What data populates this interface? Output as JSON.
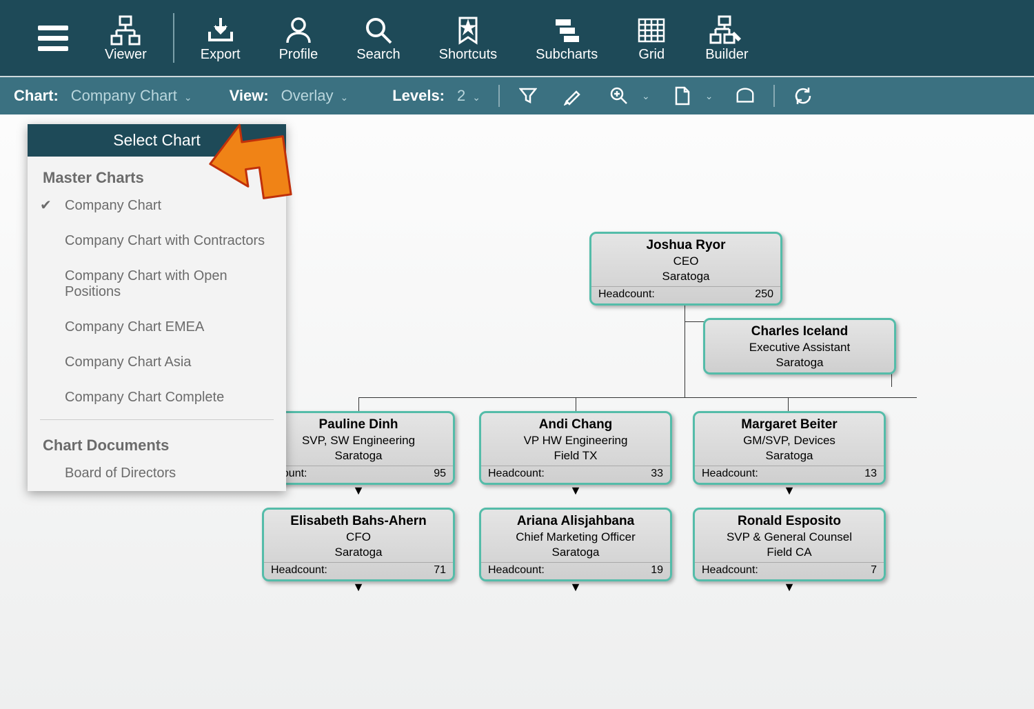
{
  "toolbar": {
    "viewer": "Viewer",
    "export": "Export",
    "profile": "Profile",
    "search": "Search",
    "shortcuts": "Shortcuts",
    "subcharts": "Subcharts",
    "grid": "Grid",
    "builder": "Builder"
  },
  "secondary": {
    "chart_label": "Chart:",
    "chart_value": "Company Chart",
    "view_label": "View:",
    "view_value": "Overlay",
    "levels_label": "Levels:",
    "levels_value": "2"
  },
  "dropdown": {
    "header": "Select Chart",
    "section1": "Master Charts",
    "items1": [
      "Company Chart",
      "Company Chart with Contractors",
      "Company Chart with Open Positions",
      "Company Chart EMEA",
      "Company Chart Asia",
      "Company Chart Complete"
    ],
    "section2": "Chart Documents",
    "items2": [
      "Board of Directors"
    ]
  },
  "nodes": {
    "headcount_label": "Headcount:",
    "n0": {
      "name": "Joshua Ryor",
      "title": "CEO",
      "loc": "Saratoga",
      "head": "250"
    },
    "n1": {
      "name": "Charles Iceland",
      "title": "Executive Assistant",
      "loc": "Saratoga"
    },
    "n2": {
      "name": "Pauline Dinh",
      "title": "SVP, SW Engineering",
      "loc": "Saratoga",
      "head": "95",
      "head_label_partial": "dcount:"
    },
    "n3": {
      "name": "Andi Chang",
      "title": "VP HW Engineering",
      "loc": "Field TX",
      "head": "33"
    },
    "n4": {
      "name": "Margaret Beiter",
      "title": "GM/SVP, Devices",
      "loc": "Saratoga",
      "head": "13"
    },
    "n5": {
      "name": "Elisabeth Bahs-Ahern",
      "title": "CFO",
      "loc": "Saratoga",
      "head": "71"
    },
    "n6": {
      "name": "Ariana Alisjahbana",
      "title": "Chief Marketing Officer",
      "loc": "Saratoga",
      "head": "19"
    },
    "n7": {
      "name": "Ronald Esposito",
      "title": "SVP & General Counsel",
      "loc": "Field CA",
      "head": "7"
    }
  }
}
